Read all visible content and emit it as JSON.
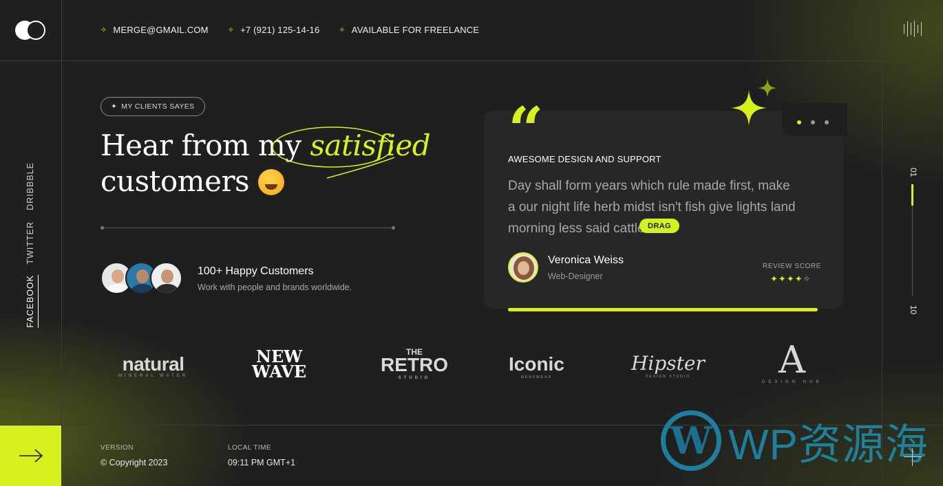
{
  "header": {
    "contacts": [
      {
        "label": "MERGE@GMAIL.COM"
      },
      {
        "label": "+7 (921) 125-14-16"
      },
      {
        "label": "AVAILABLE FOR FREELANCE"
      }
    ]
  },
  "social": {
    "dribbble": "DRIBBBLE",
    "twitter": "TWITTER",
    "facebook": "FACEBOOK"
  },
  "hero": {
    "pill": "MY CLIENTS SAYES",
    "title_start": "Hear from my",
    "title_highlight": "satisfied",
    "title_end": "customers"
  },
  "customers": {
    "title": "100+ Happy Customers",
    "subtitle": "Work with people and brands worldwide."
  },
  "testimonial": {
    "heading": "AWESOME DESIGN AND SUPPORT",
    "body": "Day shall form years which rule made first, make a our night life herb midst isn't fish give lights land morning less said cattle.",
    "drag_label": "DRAG",
    "reviewer_name": "Veronica Weiss",
    "reviewer_role": "Web-Designer",
    "review_score_label": "REVIEW SCORE",
    "rating": 4,
    "rating_max": 5,
    "slide_dots": 3,
    "active_dot": 0
  },
  "counter": {
    "current": "01",
    "total": "10",
    "progress": 0.19
  },
  "brands": {
    "natural": {
      "name": "natural",
      "tag": "MINERAL WATER"
    },
    "newwave": {
      "line1": "NEW",
      "line2": "WAVE"
    },
    "retro": {
      "top": "THE",
      "name": "RETRO",
      "tag": "STUDIO"
    },
    "iconic": {
      "name": "Iconic",
      "tag": "MENSWEAR"
    },
    "hipster": {
      "name": "Hipster",
      "tag": "DESIGN STUDIO"
    },
    "designhub": {
      "name": "A",
      "tag": "DESIGN HUB"
    }
  },
  "footer": {
    "version_label": "VERSION",
    "version_value": "© Copyright 2023",
    "time_label": "LOCAL TIME",
    "time_value": "09:11 PM GMT+1"
  },
  "watermark": {
    "text": "WP资源海",
    "logo_letter": "W"
  },
  "colors": {
    "accent": "#d6f11f",
    "background": "#1f1f1f",
    "card": "#272727"
  }
}
